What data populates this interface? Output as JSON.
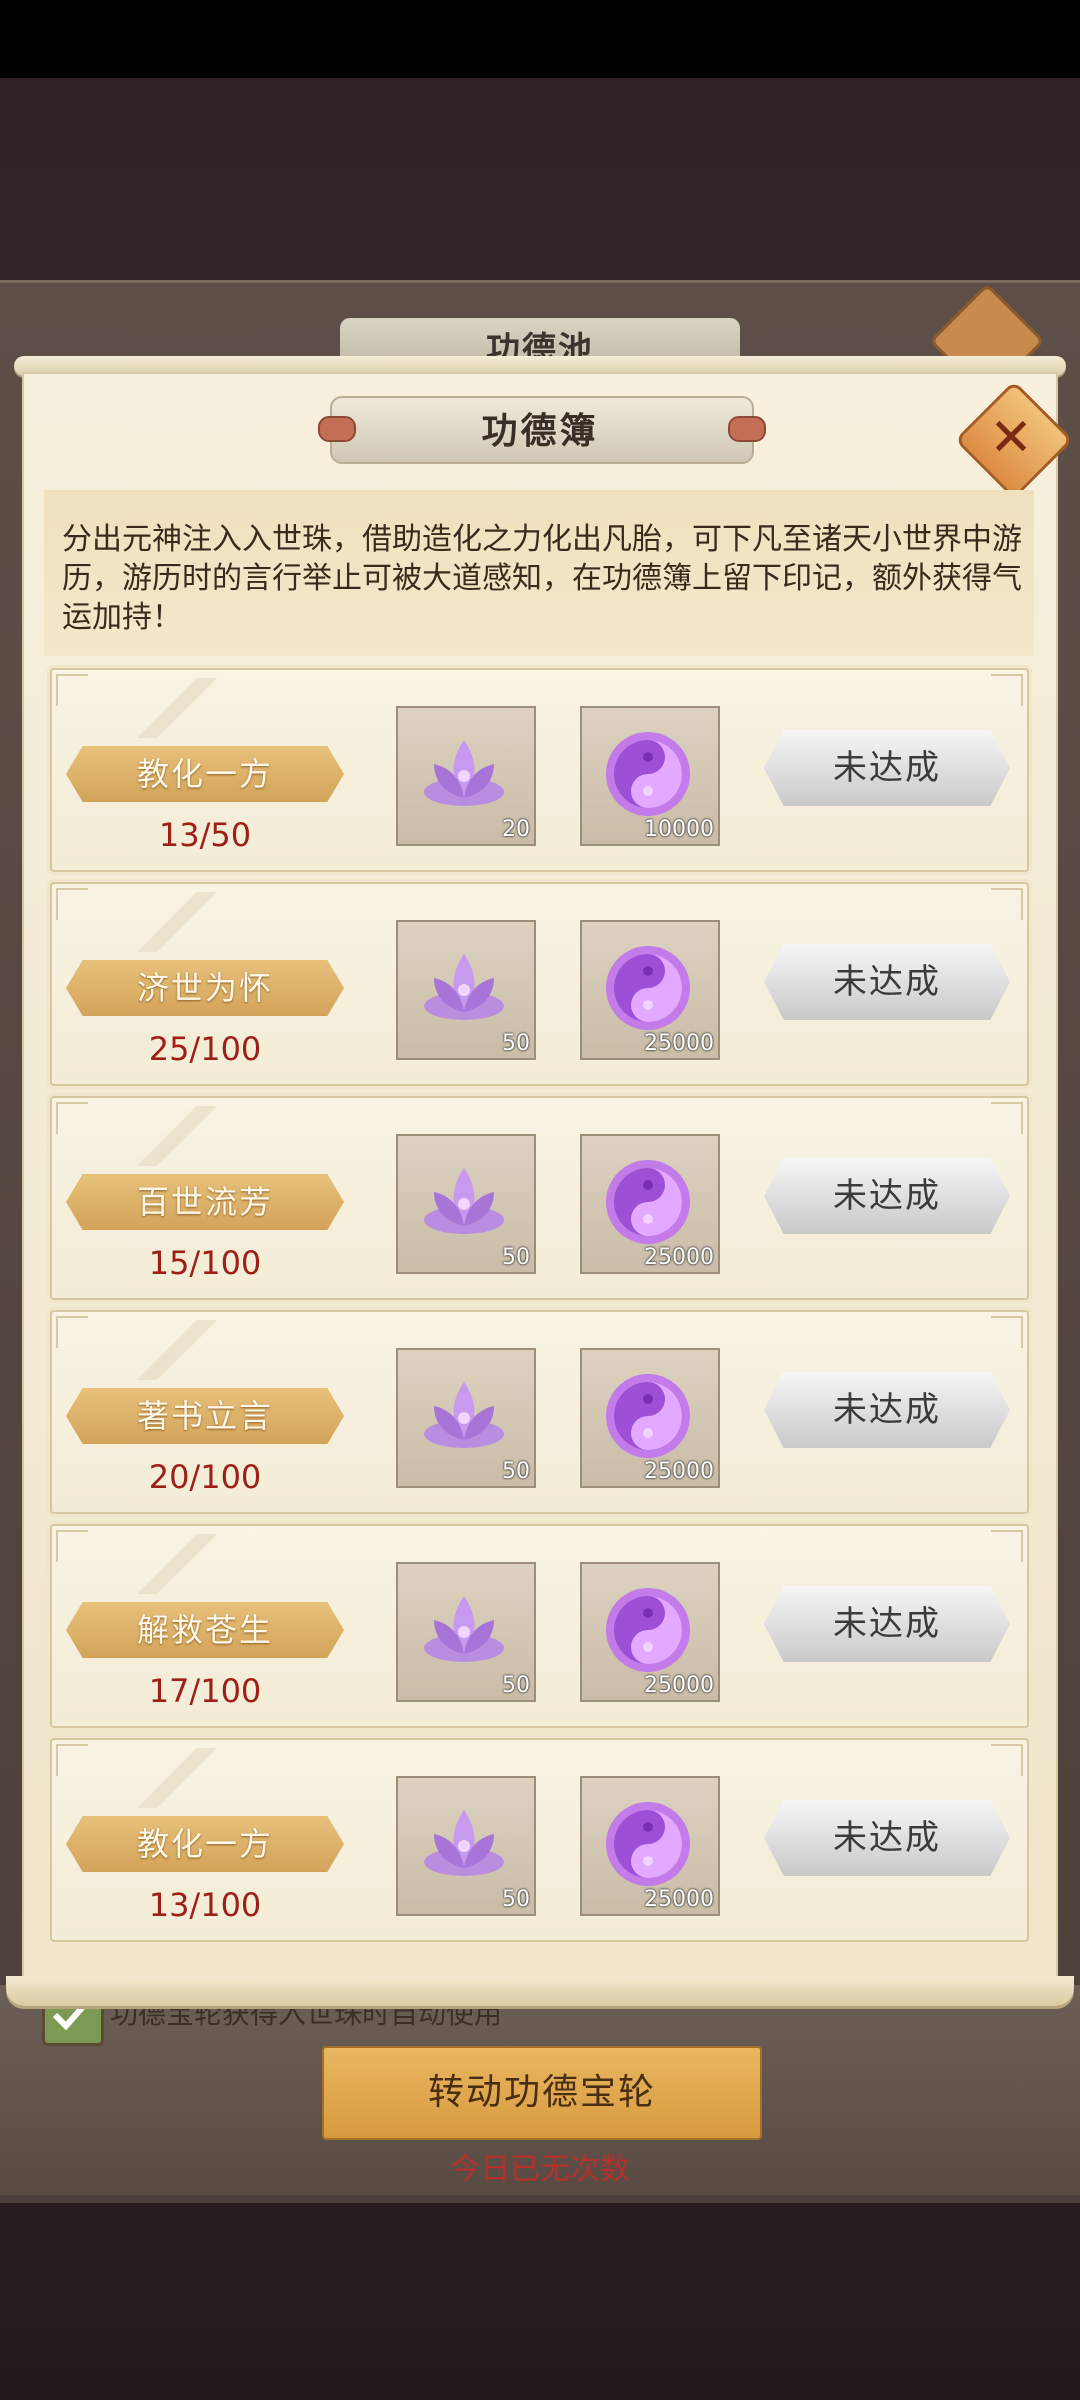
{
  "background": {
    "panel_title": "功德池",
    "auto_use_label": "功德宝轮获得入世珠时自动使用",
    "spin_button": "转动功德宝轮",
    "no_attempts_text": "今日已无次数"
  },
  "dialog": {
    "title": "功德簿",
    "description": "分出元神注入入世珠，借助造化之力化出凡胎，可下凡至诸天小世界中游历，游历时的言行举止可被大道感知，在功德簿上留下印记，额外获得气运加持！",
    "tasks": [
      {
        "name": "教化一方",
        "progress": "13/50",
        "reward1_count": "20",
        "reward2_count": "10000",
        "status": "未达成"
      },
      {
        "name": "济世为怀",
        "progress": "25/100",
        "reward1_count": "50",
        "reward2_count": "25000",
        "status": "未达成"
      },
      {
        "name": "百世流芳",
        "progress": "15/100",
        "reward1_count": "50",
        "reward2_count": "25000",
        "status": "未达成"
      },
      {
        "name": "著书立言",
        "progress": "20/100",
        "reward1_count": "50",
        "reward2_count": "25000",
        "status": "未达成"
      },
      {
        "name": "解救苍生",
        "progress": "17/100",
        "reward1_count": "50",
        "reward2_count": "25000",
        "status": "未达成"
      },
      {
        "name": "教化一方",
        "progress": "13/100",
        "reward1_count": "50",
        "reward2_count": "25000",
        "status": "未达成"
      }
    ],
    "icons": {
      "reward1": "purple-lotus-icon",
      "reward2": "purple-yinyang-orb-icon",
      "close": "close-icon"
    }
  },
  "colors": {
    "progress": "#9d1f18",
    "accent": "#d3a35a"
  }
}
